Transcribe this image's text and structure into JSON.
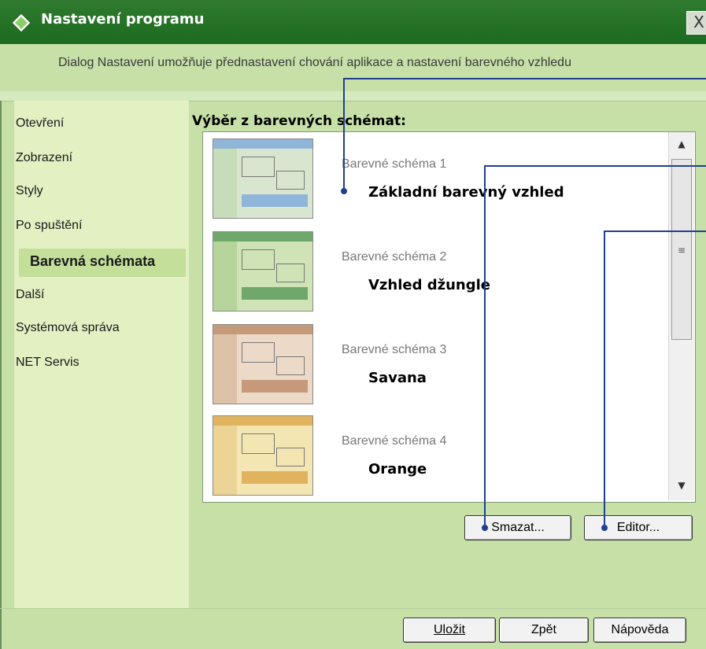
{
  "window": {
    "title": "Nastavení programu",
    "close_glyph": "X",
    "description": "Dialog Nastavení umožňuje přednastavení chování aplikace a nastavení barevného vzhledu"
  },
  "sidebar": {
    "items": [
      {
        "label": "Otevření"
      },
      {
        "label": "Zobrazení"
      },
      {
        "label": "Styly"
      },
      {
        "label": "Po spuštění"
      },
      {
        "label": "Barevná schémata",
        "active": true
      },
      {
        "label": "Další"
      },
      {
        "label": "Systémová správa"
      },
      {
        "label": "NET Servis"
      }
    ]
  },
  "main": {
    "section_label": "Výběr z barevných schémat:",
    "schemes": [
      {
        "name": "Barevné schéma 1",
        "title": "Základní barevný vzhled",
        "thumb_colors": [
          "#8fb6d8",
          "#d9e6cf",
          "#c7dcb8"
        ]
      },
      {
        "name": "Barevné schéma 2",
        "title": "Vzhled džungle",
        "thumb_colors": [
          "#6fa86a",
          "#cfe3b6",
          "#b6d49c"
        ]
      },
      {
        "name": "Barevné schéma 3",
        "title": "Savana",
        "thumb_colors": [
          "#c49a7a",
          "#ecd9c7",
          "#ddc2a8"
        ]
      },
      {
        "name": "Barevné schéma 4",
        "title": "Orange",
        "thumb_colors": [
          "#e1b35e",
          "#f4e6b2",
          "#ecd497"
        ]
      }
    ],
    "delete_label": "Smazat...",
    "editor_label": "Editor..."
  },
  "footer": {
    "save_label": "Uložit",
    "back_label": "Zpět",
    "help_label": "Nápověda"
  },
  "colors": {
    "titlebar": "#1c6b20",
    "background": "#c6e0a8",
    "sidebar": "#e2f0c2",
    "active_item": "#c3df9a",
    "callout_line": "#1f3f8f"
  }
}
